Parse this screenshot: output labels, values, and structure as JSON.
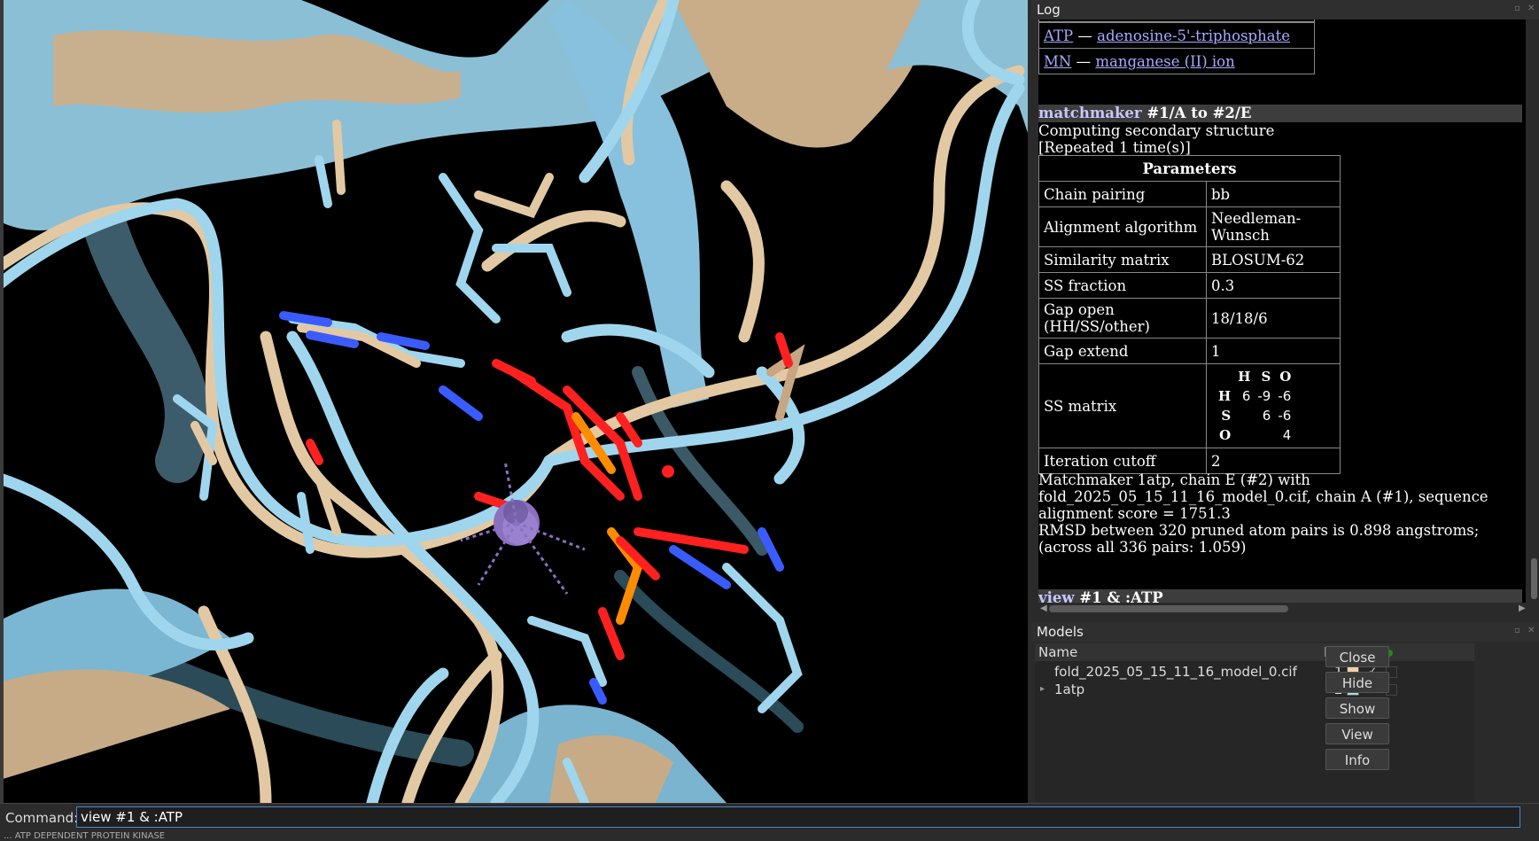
{
  "log": {
    "title": "Log",
    "residues": [
      {
        "code": "ATP",
        "name": "adenosine-5'-triphosphate"
      },
      {
        "code": "MN",
        "name": "manganese (II) ion"
      }
    ],
    "matchmaker_cmd": {
      "link": "matchmaker",
      "args": "#1/A to #2/E"
    },
    "lines1": [
      "Computing secondary structure",
      "[Repeated 1 time(s)]"
    ],
    "params_title": "Parameters",
    "params": [
      {
        "k": "Chain pairing",
        "v": "bb"
      },
      {
        "k": "Alignment algorithm",
        "v": "Needleman-Wunsch"
      },
      {
        "k": "Similarity matrix",
        "v": "BLOSUM-62"
      },
      {
        "k": "SS fraction",
        "v": "0.3"
      },
      {
        "k": "Gap open (HH/SS/other)",
        "v": "18/18/6"
      },
      {
        "k": "Gap extend",
        "v": "1"
      }
    ],
    "ss_matrix_label": "SS matrix",
    "ss_matrix": {
      "header": [
        "H",
        "S",
        "O"
      ],
      "rows": [
        {
          "h": "H",
          "v": [
            "6",
            "-9",
            "-6"
          ]
        },
        {
          "h": "S",
          "v": [
            "",
            "6",
            "-6"
          ]
        },
        {
          "h": "O",
          "v": [
            "",
            "",
            "4"
          ]
        }
      ]
    },
    "iteration": {
      "k": "Iteration cutoff",
      "v": "2"
    },
    "result": [
      "Matchmaker 1atp, chain E (#2) with",
      "fold_2025_05_15_11_16_model_0.cif, chain A (#1), sequence",
      "alignment score = 1751.3",
      "RMSD between 320 pruned atom pairs is 0.898 angstroms;",
      "(across all 336 pairs: 1.059)"
    ],
    "view_cmd": {
      "link": "view",
      "args": "#1 & :ATP"
    }
  },
  "models": {
    "title": "Models",
    "columns": {
      "name": "Name",
      "id": "ID"
    },
    "rows": [
      {
        "name": "fold_2025_05_15_11_16_model_0.cif",
        "id": "1",
        "color": "#f0d2a8",
        "shown": "✓"
      },
      {
        "name": "1atp",
        "id": "2",
        "color": "#a9d9f0",
        "shown": "✓"
      }
    ],
    "buttons": [
      "Close",
      "Hide",
      "Show",
      "View",
      "Info"
    ]
  },
  "command": {
    "label": "Command:",
    "value": "view #1 & :ATP"
  },
  "status_text": "... ATP DEPENDENT PROTEIN KINASE",
  "colors": {
    "tan": "#d9bf9a",
    "sky": "#8fd0ec",
    "oxygen": "#ff1a1a",
    "nitrogen": "#3a5cff",
    "phosphorus": "#ff8c00",
    "manganese": "#8a70c0"
  }
}
